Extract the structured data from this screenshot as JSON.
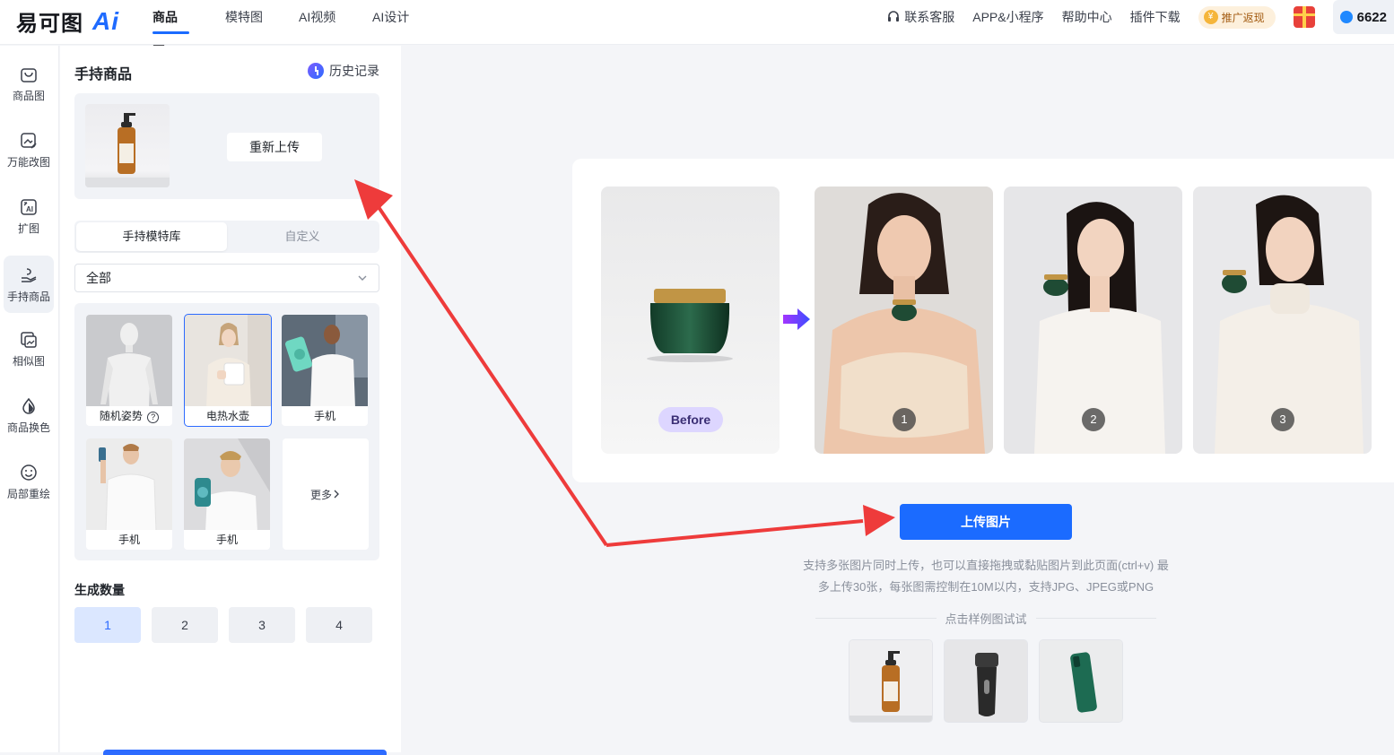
{
  "header": {
    "logo_text": "易可图",
    "logo_ai": "Ai",
    "nav": [
      {
        "label": "商品图",
        "active": true
      },
      {
        "label": "模特图",
        "active": false
      },
      {
        "label": "AI视频",
        "active": false
      },
      {
        "label": "AI设计",
        "active": false
      }
    ],
    "right": {
      "support": "联系客服",
      "app": "APP&小程序",
      "help": "帮助中心",
      "plugin": "插件下载",
      "promo": "推广返现",
      "credits": "6622"
    }
  },
  "rail": {
    "items": [
      {
        "label": "商品图",
        "icon": "bag-icon"
      },
      {
        "label": "万能改图",
        "icon": "image-edit-icon"
      },
      {
        "label": "扩图",
        "icon": "expand-ai-icon"
      },
      {
        "label": "手持商品",
        "icon": "hand-hold-icon",
        "active": true
      },
      {
        "label": "相似图",
        "icon": "similar-image-icon"
      },
      {
        "label": "商品换色",
        "icon": "color-drop-icon"
      },
      {
        "label": "局部重绘",
        "icon": "smile-icon"
      }
    ]
  },
  "panel": {
    "title": "手持商品",
    "history": "历史记录",
    "reupload": "重新上传",
    "tabs": [
      {
        "label": "手持模特库",
        "active": true
      },
      {
        "label": "自定义",
        "active": false
      }
    ],
    "filter": "全部",
    "models": [
      {
        "label": "随机姿势",
        "help": "?"
      },
      {
        "label": "电热水壶",
        "selected": true
      },
      {
        "label": "手机"
      },
      {
        "label": "手机"
      },
      {
        "label": "手机"
      }
    ],
    "more": "更多",
    "count_label": "生成数量",
    "counts": [
      "1",
      "2",
      "3",
      "4"
    ],
    "count_selected": "1"
  },
  "showcase": {
    "before": "Before",
    "numbers": [
      "1",
      "2",
      "3"
    ]
  },
  "upload": {
    "button": "上传图片",
    "hint_line1": "支持多张图片同时上传，也可以直接拖拽或黏贴图片到此页面(ctrl+v) 最",
    "hint_line2": "多上传30张，每张图需控制在10M以内，支持JPG、JPEG或PNG",
    "sample_title": "点击样例图试试"
  },
  "colors": {
    "accent": "#1b6bff",
    "arrow": "#ee3b3b"
  }
}
